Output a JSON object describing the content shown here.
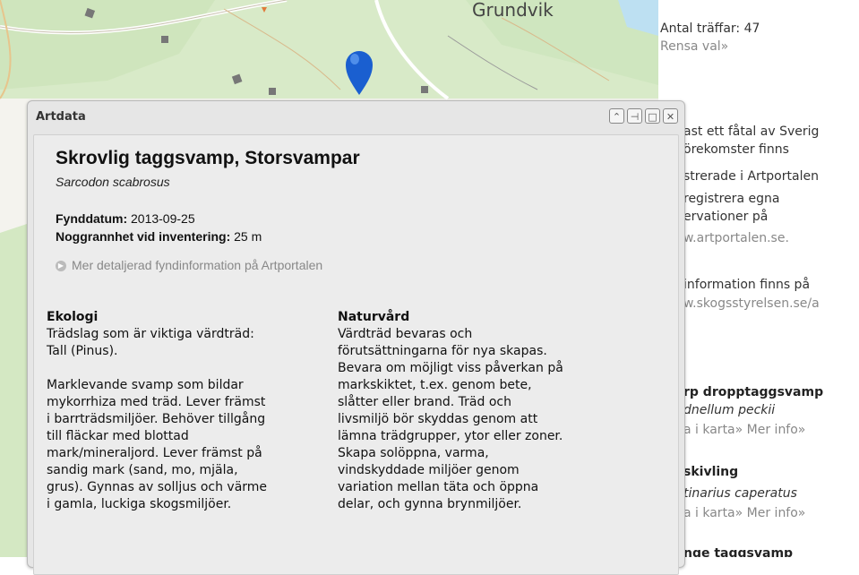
{
  "map": {
    "place_label": "Grundvik"
  },
  "sidebar": {
    "hits_label": "Antal träffar: 47",
    "clear_link": "Rensa val»",
    "info_lines": [
      "ast ett fåtal av Sverig",
      "örekomster finns",
      "strerade i Artportalen",
      "registrera egna",
      "ervationer på",
      "w.artportalen.se."
    ],
    "info2_lines": [
      "information finns på",
      "w.skogsstyrelsen.se/a"
    ],
    "results": [
      {
        "name": "rp dropptaggsvamp",
        "latin": "dnellum peckii",
        "links": "a i karta» Mer info»"
      },
      {
        "name": "skivling",
        "latin": "tinarius caperatus",
        "links": "a i karta» Mer info»"
      },
      {
        "name": "nge taggsvamp",
        "latin": "",
        "links": ""
      }
    ]
  },
  "popup": {
    "title": "Artdata",
    "controls": [
      "collapse-icon",
      "pin-icon",
      "maximize-icon",
      "close-icon"
    ],
    "species_title": "Skrovlig taggsvamp, Storsvampar",
    "species_latin": "Sarcodon scabrosus",
    "find_date_label": "Fynddatum:",
    "find_date_value": "2013-09-25",
    "accuracy_label": "Noggrannhet vid inventering:",
    "accuracy_value": "25 m",
    "more_link": "Mer detaljerad fyndinformation på Artportalen",
    "ekologi": {
      "heading": "Ekologi",
      "text1": "Trädslag som är viktiga värdträd:\nTall (Pinus).",
      "text2": "Marklevande svamp som bildar\nmykorrhiza med träd. Lever främst\ni barrträdsmiljöer. Behöver tillgång\ntill fläckar med blottad\nmark/mineraljord. Lever främst på\nsandig mark (sand, mo, mjäla,\ngrus). Gynnas av solljus och värme\ni gamla, luckiga skogsmiljöer."
    },
    "naturvard": {
      "heading": "Naturvård",
      "text": "Värdträd bevaras och\nförutsättningarna för nya skapas.\nBevara om möjligt viss påverkan på\nmarkskiktet, t.ex. genom bete,\nslåtter eller brand. Träd och\nlivsmiljö bör skyddas genom att\nlämna trädgrupper, ytor eller zoner.\nSkapa solöppna, varma,\nvindskyddade miljöer genom\nvariation mellan täta och öppna\ndelar, och gynna brynmiljöer."
    }
  },
  "colors": {
    "forest": "#d4e8c3",
    "water": "#bde0f2",
    "marker": "#1a5fd0"
  }
}
